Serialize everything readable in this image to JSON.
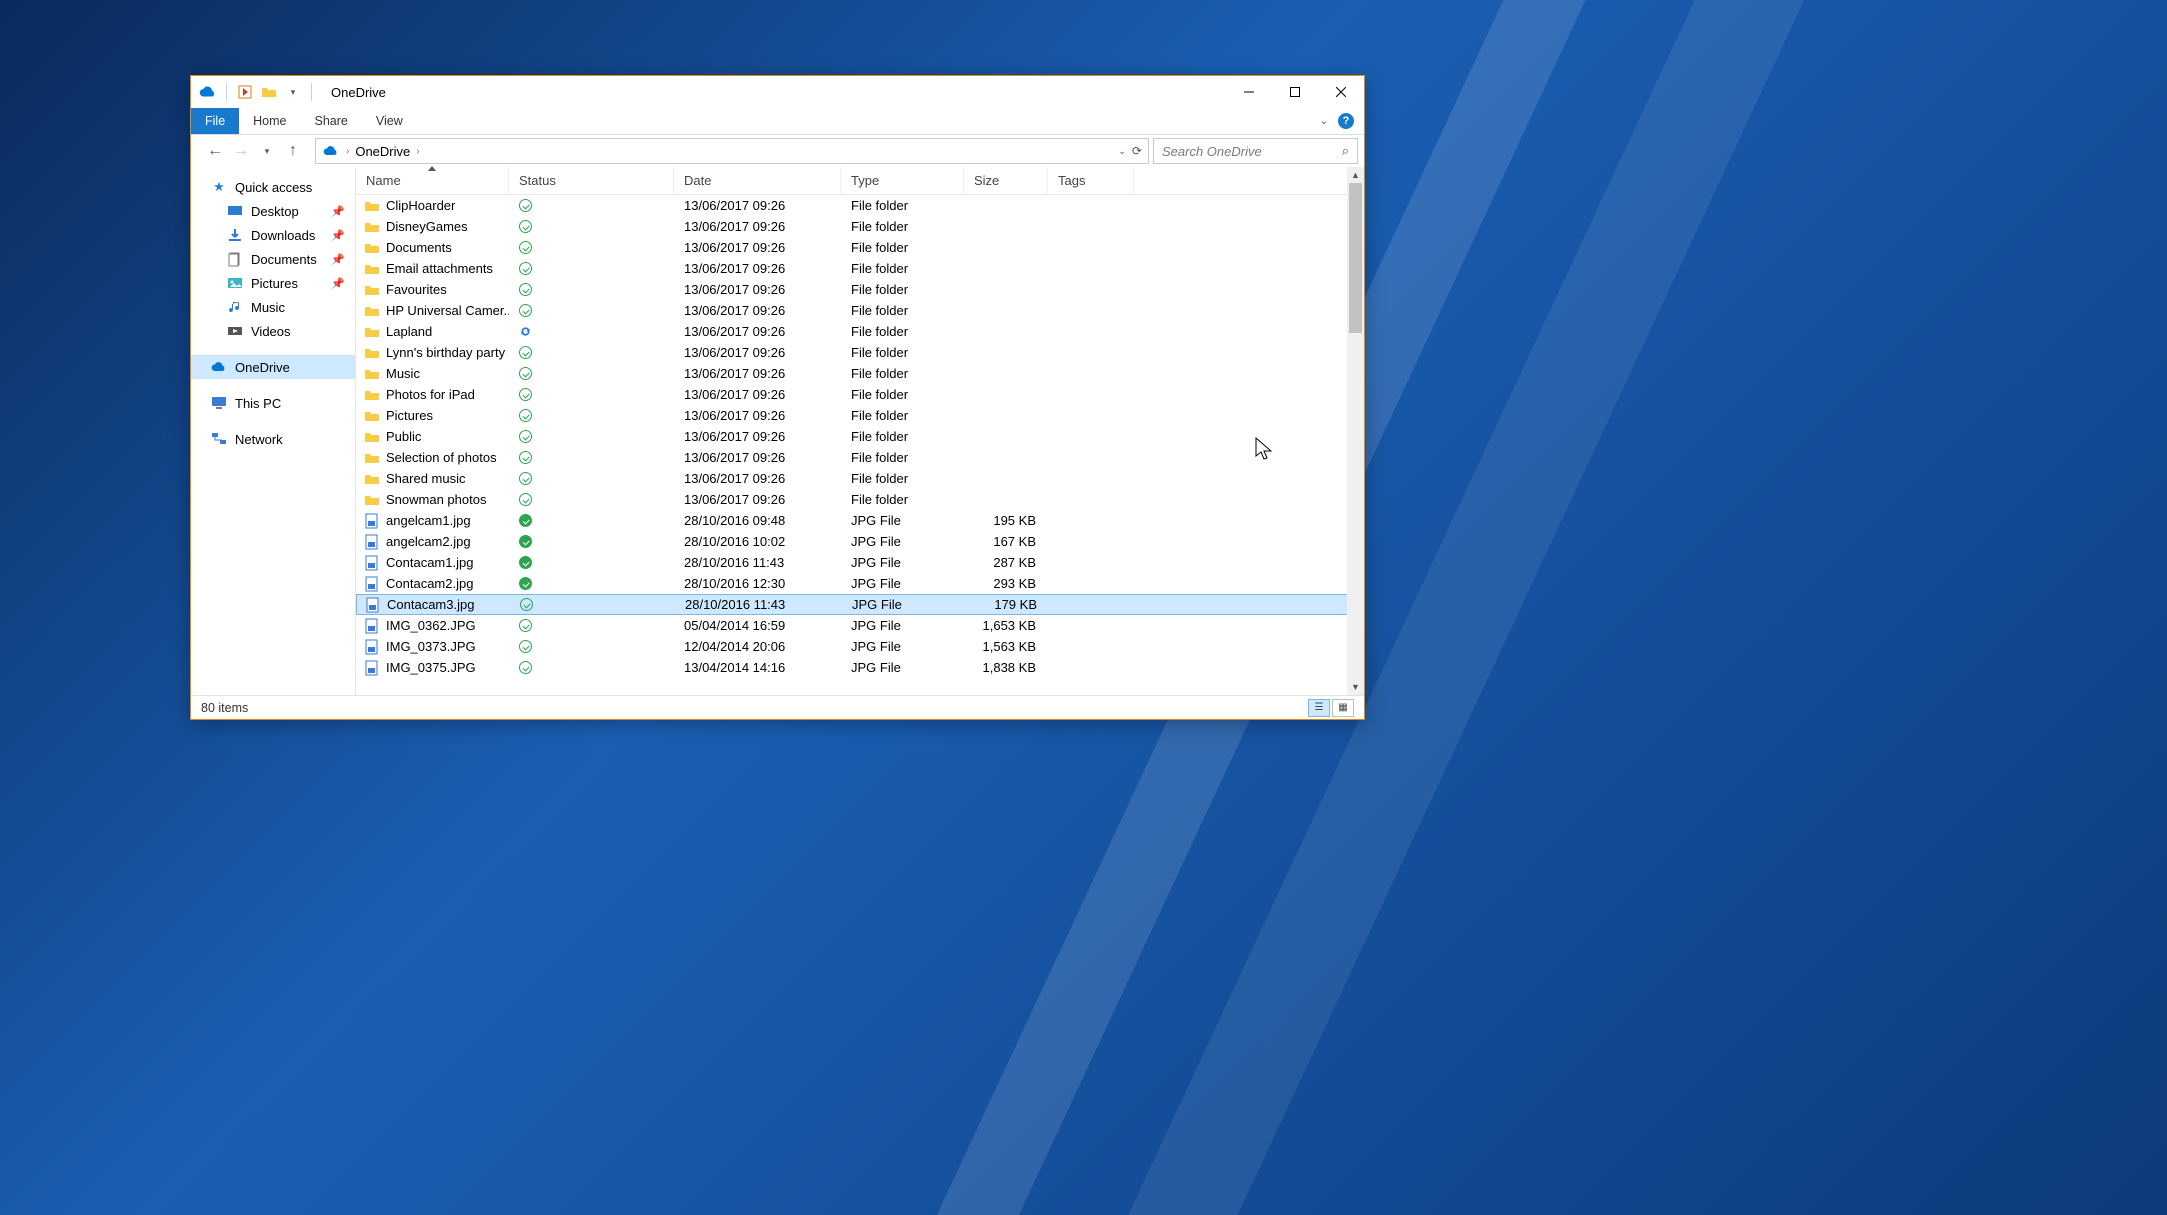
{
  "window": {
    "title": "OneDrive"
  },
  "ribbon": {
    "file": "File",
    "tabs": [
      "Home",
      "Share",
      "View"
    ]
  },
  "address": {
    "location": "OneDrive",
    "search_placeholder": "Search OneDrive"
  },
  "nav": {
    "quick_access": "Quick access",
    "quick_items": [
      {
        "label": "Desktop",
        "icon": "desktop",
        "pinned": true
      },
      {
        "label": "Downloads",
        "icon": "downloads",
        "pinned": true
      },
      {
        "label": "Documents",
        "icon": "documents",
        "pinned": true
      },
      {
        "label": "Pictures",
        "icon": "pictures",
        "pinned": true
      },
      {
        "label": "Music",
        "icon": "music",
        "pinned": false
      },
      {
        "label": "Videos",
        "icon": "videos",
        "pinned": false
      }
    ],
    "onedrive": "OneDrive",
    "thispc": "This PC",
    "network": "Network"
  },
  "columns": {
    "name": "Name",
    "status": "Status",
    "date": "Date",
    "type": "Type",
    "size": "Size",
    "tags": "Tags"
  },
  "files": [
    {
      "name": "ClipHoarder",
      "status": "ok",
      "date": "13/06/2017 09:26",
      "type": "File folder",
      "size": "",
      "icon": "folder"
    },
    {
      "name": "DisneyGames",
      "status": "ok",
      "date": "13/06/2017 09:26",
      "type": "File folder",
      "size": "",
      "icon": "folder"
    },
    {
      "name": "Documents",
      "status": "ok",
      "date": "13/06/2017 09:26",
      "type": "File folder",
      "size": "",
      "icon": "folder"
    },
    {
      "name": "Email attachments",
      "status": "ok",
      "date": "13/06/2017 09:26",
      "type": "File folder",
      "size": "",
      "icon": "folder"
    },
    {
      "name": "Favourites",
      "status": "ok",
      "date": "13/06/2017 09:26",
      "type": "File folder",
      "size": "",
      "icon": "folder"
    },
    {
      "name": "HP Universal Camer...",
      "status": "ok",
      "date": "13/06/2017 09:26",
      "type": "File folder",
      "size": "",
      "icon": "folder"
    },
    {
      "name": "Lapland",
      "status": "sync",
      "date": "13/06/2017 09:26",
      "type": "File folder",
      "size": "",
      "icon": "folder"
    },
    {
      "name": "Lynn's birthday party",
      "status": "ok",
      "date": "13/06/2017 09:26",
      "type": "File folder",
      "size": "",
      "icon": "folder"
    },
    {
      "name": "Music",
      "status": "ok",
      "date": "13/06/2017 09:26",
      "type": "File folder",
      "size": "",
      "icon": "folder"
    },
    {
      "name": "Photos for iPad",
      "status": "ok",
      "date": "13/06/2017 09:26",
      "type": "File folder",
      "size": "",
      "icon": "folder"
    },
    {
      "name": "Pictures",
      "status": "ok",
      "date": "13/06/2017 09:26",
      "type": "File folder",
      "size": "",
      "icon": "folder"
    },
    {
      "name": "Public",
      "status": "ok",
      "date": "13/06/2017 09:26",
      "type": "File folder",
      "size": "",
      "icon": "folder"
    },
    {
      "name": "Selection of photos",
      "status": "ok",
      "date": "13/06/2017 09:26",
      "type": "File folder",
      "size": "",
      "icon": "folder"
    },
    {
      "name": "Shared music",
      "status": "ok",
      "date": "13/06/2017 09:26",
      "type": "File folder",
      "size": "",
      "icon": "folder"
    },
    {
      "name": "Snowman photos",
      "status": "ok",
      "date": "13/06/2017 09:26",
      "type": "File folder",
      "size": "",
      "icon": "folder"
    },
    {
      "name": "angelcam1.jpg",
      "status": "ok-solid",
      "date": "28/10/2016 09:48",
      "type": "JPG File",
      "size": "195 KB",
      "icon": "jpg"
    },
    {
      "name": "angelcam2.jpg",
      "status": "ok-solid",
      "date": "28/10/2016 10:02",
      "type": "JPG File",
      "size": "167 KB",
      "icon": "jpg"
    },
    {
      "name": "Contacam1.jpg",
      "status": "ok-solid",
      "date": "28/10/2016 11:43",
      "type": "JPG File",
      "size": "287 KB",
      "icon": "jpg"
    },
    {
      "name": "Contacam2.jpg",
      "status": "ok-solid",
      "date": "28/10/2016 12:30",
      "type": "JPG File",
      "size": "293 KB",
      "icon": "jpg"
    },
    {
      "name": "Contacam3.jpg",
      "status": "ok",
      "date": "28/10/2016 11:43",
      "type": "JPG File",
      "size": "179 KB",
      "icon": "jpg",
      "selected": true
    },
    {
      "name": "IMG_0362.JPG",
      "status": "ok",
      "date": "05/04/2014 16:59",
      "type": "JPG File",
      "size": "1,653 KB",
      "icon": "jpg"
    },
    {
      "name": "IMG_0373.JPG",
      "status": "ok",
      "date": "12/04/2014 20:06",
      "type": "JPG File",
      "size": "1,563 KB",
      "icon": "jpg"
    },
    {
      "name": "IMG_0375.JPG",
      "status": "ok",
      "date": "13/04/2014 14:16",
      "type": "JPG File",
      "size": "1,838 KB",
      "icon": "jpg"
    }
  ],
  "statusbar": {
    "count": "80 items"
  }
}
